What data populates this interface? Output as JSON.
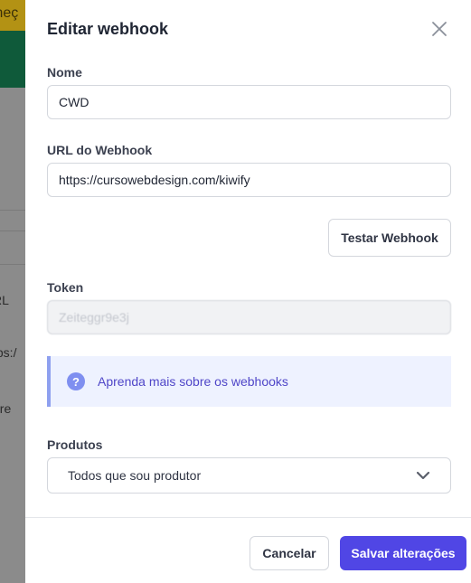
{
  "background": {
    "banner_fragment": "meç",
    "column_header_fragment": "RL",
    "url_fragment": "tps:/",
    "text_fragment": "bre"
  },
  "drawer": {
    "title": "Editar webhook",
    "name_label": "Nome",
    "name_value": "CWD",
    "url_label": "URL do Webhook",
    "url_value": "https://cursowebdesign.com/kiwify",
    "test_button": "Testar Webhook",
    "token_label": "Token",
    "token_value": "Zeiteggr9e3j",
    "info_icon_text": "?",
    "info_link": "Aprenda mais sobre os webhooks",
    "products_label": "Produtos",
    "products_value": "Todos que sou produtor",
    "cancel_button": "Cancelar",
    "save_button": "Salvar alterações"
  },
  "icons": {
    "close": "close-icon",
    "info": "question-icon",
    "chevron": "chevron-down-icon"
  },
  "colors": {
    "primary": "#5046e5",
    "info_bg": "#eef2ff",
    "info_text": "#4f46c8"
  }
}
